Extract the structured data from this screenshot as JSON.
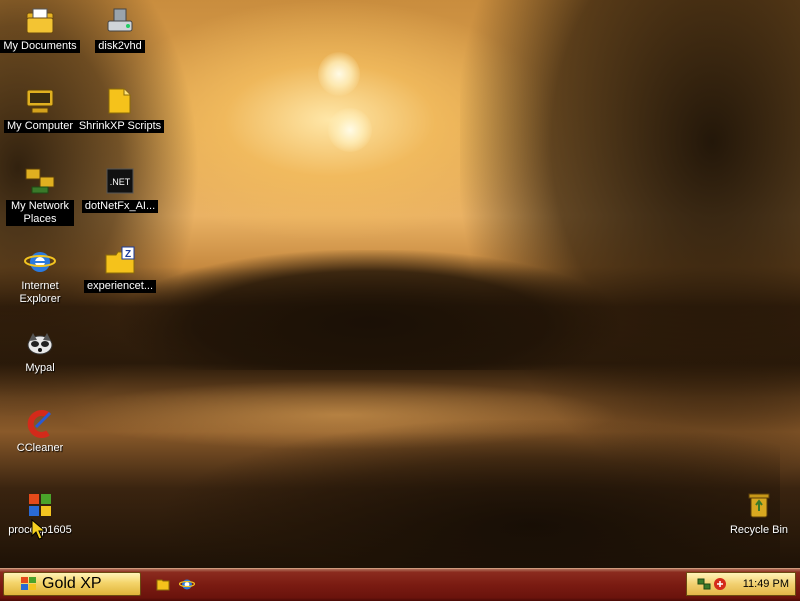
{
  "desktop": {
    "icons": [
      {
        "label": "My Documents"
      },
      {
        "label": "disk2vhd"
      },
      {
        "label": "My Computer"
      },
      {
        "label": "ShrinkXP Scripts"
      },
      {
        "label": "My Network Places"
      },
      {
        "label": "dotNetFx_AI..."
      },
      {
        "label": "Internet Explorer"
      },
      {
        "label": "experiencet..."
      },
      {
        "label": "Mypal"
      },
      {
        "label": "CCleaner"
      },
      {
        "label": "procexp1605"
      },
      {
        "label": "Recycle Bin"
      }
    ],
    "net_badge": ".NET"
  },
  "taskbar": {
    "start_label": "Gold XP",
    "quick_launch": [
      {
        "icon": "folder-icon"
      },
      {
        "icon": "internet-explorer-icon"
      }
    ],
    "tray": {
      "time": "11:49 PM"
    }
  }
}
